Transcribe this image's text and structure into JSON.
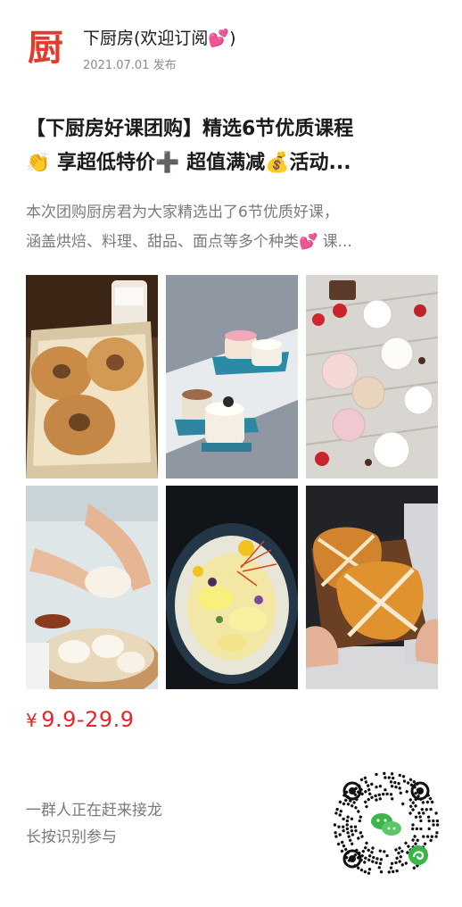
{
  "header": {
    "logo_glyph": "厨",
    "group_name": "下厨房(欢迎订阅💕)",
    "post_date": "2021.07.01 发布"
  },
  "title": {
    "line1": "【下厨房好课团购】精选6节优质课程",
    "line2": "👏 享超低特价➕ 超值满减💰活动..."
  },
  "description": {
    "line1": "本次团购厨房君为大家精选出了6节优质好课，",
    "line2": "涵盖烘焙、料理、甜品、面点等多个种类💕 课..."
  },
  "gallery": {
    "photos": [
      "sugar-donuts-photo",
      "drip-cakes-photo",
      "dessert-cups-photo",
      "dumplings-photo",
      "egg-dish-photo",
      "cross-buns-photo"
    ]
  },
  "price": {
    "currency": "¥",
    "range": "9.9-29.9"
  },
  "cta": {
    "line1": "一群人正在赶来接龙",
    "line2": "长按识别参与"
  },
  "colors": {
    "accent": "#e8262b",
    "logo": "#e23b2e",
    "muted": "#7a7a7a",
    "qr_green": "#3bb54a"
  }
}
